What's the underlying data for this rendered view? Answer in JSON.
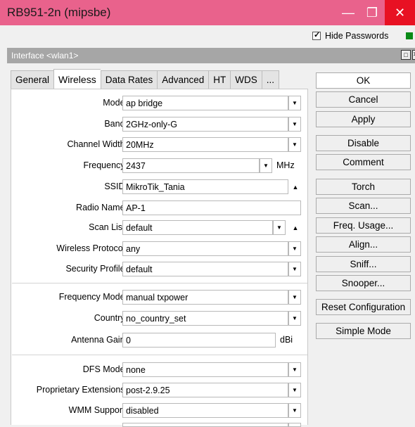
{
  "window": {
    "title": "RB951-2n (mipsbe)"
  },
  "toolbar": {
    "hide_passwords": "Hide Passwords",
    "hide_passwords_checked": true
  },
  "dialog": {
    "title": "Interface <wlan1>"
  },
  "tabs": [
    "General",
    "Wireless",
    "Data Rates",
    "Advanced",
    "HT",
    "WDS",
    "..."
  ],
  "active_tab": "Wireless",
  "fields": {
    "mode": {
      "label": "Mode:",
      "value": "ap bridge"
    },
    "band": {
      "label": "Band:",
      "value": "2GHz-only-G"
    },
    "channel_width": {
      "label": "Channel Width:",
      "value": "20MHz"
    },
    "frequency": {
      "label": "Frequency:",
      "value": "2437",
      "unit": "MHz"
    },
    "ssid": {
      "label": "SSID:",
      "value": "MikroTik_Tania"
    },
    "radio_name": {
      "label": "Radio Name:",
      "value": "AP-1"
    },
    "scan_list": {
      "label": "Scan List:",
      "value": "default"
    },
    "wireless_protocol": {
      "label": "Wireless Protocol:",
      "value": "any"
    },
    "security_profile": {
      "label": "Security Profile:",
      "value": "default"
    },
    "frequency_mode": {
      "label": "Frequency Mode:",
      "value": "manual txpower"
    },
    "country": {
      "label": "Country:",
      "value": "no_country_set"
    },
    "antenna_gain": {
      "label": "Antenna Gain:",
      "value": "0",
      "unit": "dBi"
    },
    "dfs_mode": {
      "label": "DFS Mode:",
      "value": "none"
    },
    "proprietary_extensions": {
      "label": "Proprietary Extensions:",
      "value": "post-2.9.25"
    },
    "wmm_support": {
      "label": "WMM Support:",
      "value": "disabled"
    }
  },
  "buttons": {
    "ok": "OK",
    "cancel": "Cancel",
    "apply": "Apply",
    "disable": "Disable",
    "comment": "Comment",
    "torch": "Torch",
    "scan": "Scan...",
    "freq_usage": "Freq. Usage...",
    "align": "Align...",
    "sniff": "Sniff...",
    "snooper": "Snooper...",
    "reset_config": "Reset Configuration",
    "simple_mode": "Simple Mode"
  },
  "colors": {
    "titlebar": "#e9628c",
    "close": "#e81123",
    "dialog_header": "#a6a6a6",
    "status_green": "#0a8a17"
  }
}
